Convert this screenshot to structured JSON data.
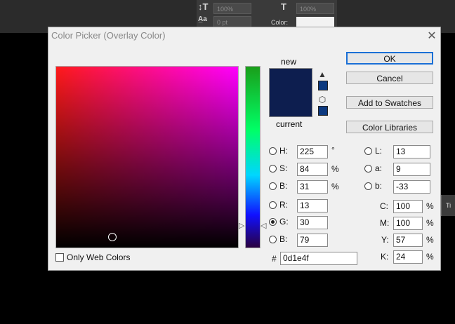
{
  "background": {
    "opacity_value_1": "100%",
    "opacity_value_2": "100%",
    "size_value": "0 pt",
    "color_label": "Color:",
    "right_tab_label": "Ti"
  },
  "dialog": {
    "title": "Color Picker (Overlay Color)",
    "labels": {
      "new": "new",
      "current": "current"
    },
    "selected_color_hex": "#0d1e4f",
    "buttons": {
      "ok": "OK",
      "cancel": "Cancel",
      "add_to_swatches": "Add to Swatches",
      "color_libraries": "Color Libraries"
    },
    "fields": {
      "H": {
        "label": "H:",
        "value": "225",
        "unit": "°"
      },
      "S": {
        "label": "S:",
        "value": "84",
        "unit": "%"
      },
      "B": {
        "label": "B:",
        "value": "31",
        "unit": "%"
      },
      "R": {
        "label": "R:",
        "value": "13"
      },
      "G": {
        "label": "G:",
        "value": "30"
      },
      "Bb": {
        "label": "B:",
        "value": "79"
      },
      "L": {
        "label": "L:",
        "value": "13"
      },
      "a": {
        "label": "a:",
        "value": "9"
      },
      "b": {
        "label": "b:",
        "value": "-33"
      },
      "C": {
        "label": "C:",
        "value": "100",
        "unit": "%"
      },
      "M": {
        "label": "M:",
        "value": "100",
        "unit": "%"
      },
      "Y": {
        "label": "Y:",
        "value": "57",
        "unit": "%"
      },
      "K": {
        "label": "K:",
        "value": "24",
        "unit": "%"
      }
    },
    "hex_label": "#",
    "hex_value": "0d1e4f",
    "only_web_colors": "Only Web Colors",
    "selected_channel": "G"
  }
}
